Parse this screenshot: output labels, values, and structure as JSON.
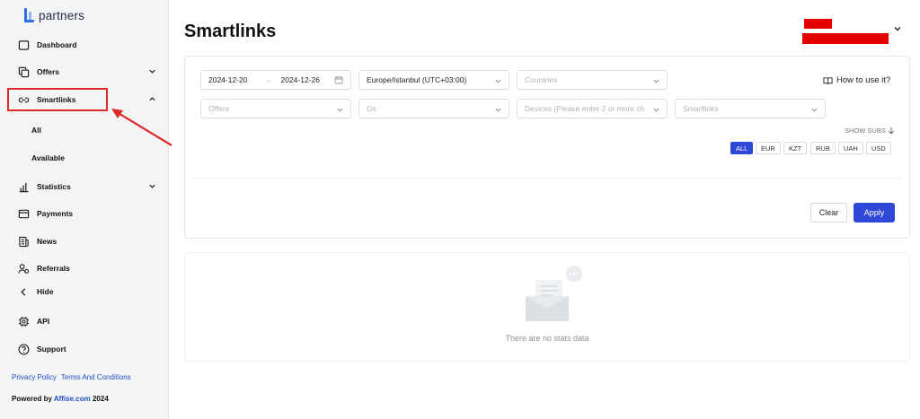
{
  "brand": {
    "logo_text": "partners"
  },
  "sidebar": {
    "items": [
      {
        "label": "Dashboard",
        "icon": "dashboard-icon"
      },
      {
        "label": "Offers",
        "icon": "offers-icon"
      },
      {
        "label": "Smartlinks",
        "icon": "link-icon"
      },
      {
        "label": "Statistics",
        "icon": "bar-chart-icon"
      },
      {
        "label": "Payments",
        "icon": "card-icon"
      },
      {
        "label": "News",
        "icon": "news-icon"
      },
      {
        "label": "Referrals",
        "icon": "referrals-icon"
      },
      {
        "label": "Hide",
        "icon": "chevron-left-icon"
      },
      {
        "label": "API",
        "icon": "chip-icon"
      },
      {
        "label": "Support",
        "icon": "help-icon"
      }
    ],
    "subitems": [
      "All",
      "Available"
    ]
  },
  "footer": {
    "privacy": "Privacy Policy",
    "terms": "Terms And Conditions",
    "powered_prefix": "Powered by",
    "powered_link": "Affise.com",
    "year": "2024"
  },
  "page": {
    "title": "Smartlinks"
  },
  "filters": {
    "date_from": "2024-12-20",
    "date_to": "2024-12-26",
    "date_sep": "→",
    "timezone": "Europe/Istanbul (UTC+03:00)",
    "countries_placeholder": "Countries",
    "offers_placeholder": "Offers",
    "os_placeholder": "Os",
    "devices_placeholder": "Devices (Please enter 2 or more ch",
    "smartlinks_placeholder": "Smartlinks",
    "how_to": "How to use it?",
    "show_subs": "SHOW SUBS",
    "currencies": [
      "ALL",
      "EUR",
      "KZT",
      "RUB",
      "UAH",
      "USD"
    ],
    "active_currency": "ALL"
  },
  "actions": {
    "clear": "Clear",
    "apply": "Apply"
  },
  "empty": {
    "message": "There are no stats data"
  },
  "colors": {
    "accent": "#2f48d6",
    "highlight": "#e02a2a",
    "redaction": "#e40000"
  }
}
